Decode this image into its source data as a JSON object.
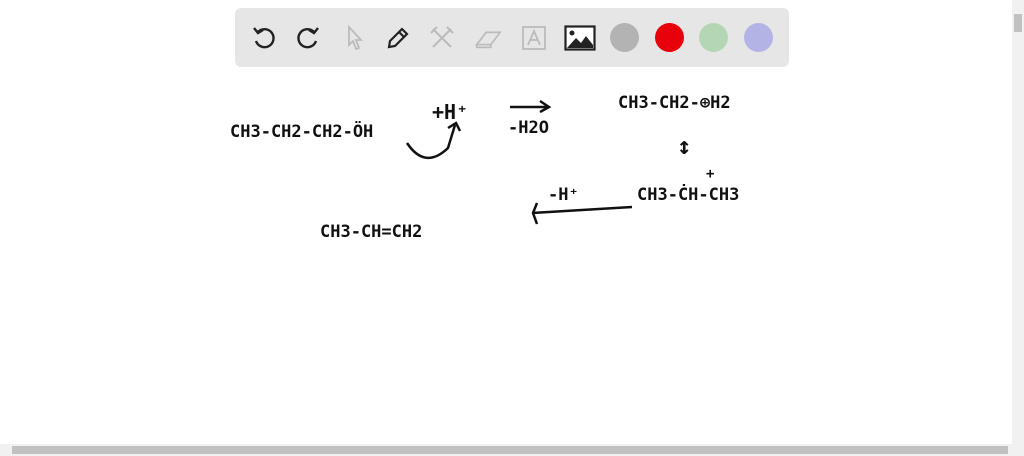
{
  "toolbar": {
    "tools": [
      "undo-icon",
      "redo-icon",
      "select-icon",
      "pen-icon",
      "tools-icon",
      "eraser-icon",
      "text-icon",
      "image-icon"
    ],
    "colors": [
      "#b3b3b3",
      "#e8000b",
      "#b5d6b5",
      "#b3b3e6"
    ]
  },
  "canvas": {
    "line1_reactant": "CH3-CH2-CH2-ÖH",
    "line1_plus_h": "+H⁺",
    "line1_condition": "-H2O",
    "line1_product": "CH3-CH2-⊕H2",
    "resonance": "↕",
    "line2_cation": "CH3-ĊH-CH3",
    "line2_plus": "+",
    "line2_condition": "-H⁺",
    "line2_product": "CH3-CH=CH2"
  }
}
